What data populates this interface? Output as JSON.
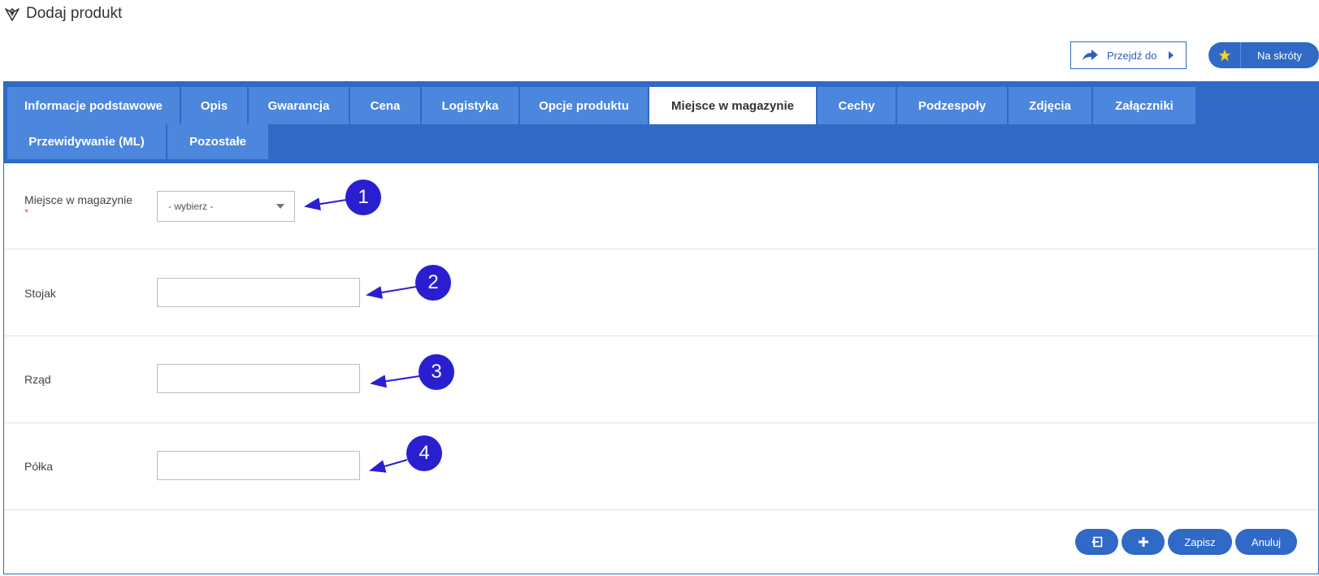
{
  "header": {
    "title": "Dodaj produkt",
    "goto_label": "Przejdź do",
    "shortcut_label": "Na skróty"
  },
  "tabs": [
    {
      "label": "Informacje podstawowe",
      "active": false
    },
    {
      "label": "Opis",
      "active": false
    },
    {
      "label": "Gwarancja",
      "active": false
    },
    {
      "label": "Cena",
      "active": false
    },
    {
      "label": "Logistyka",
      "active": false
    },
    {
      "label": "Opcje produktu",
      "active": false
    },
    {
      "label": "Miejsce w magazynie",
      "active": true
    },
    {
      "label": "Cechy",
      "active": false
    },
    {
      "label": "Podzespoły",
      "active": false
    },
    {
      "label": "Zdjęcia",
      "active": false
    },
    {
      "label": "Załączniki",
      "active": false
    },
    {
      "label": "Przewidywanie (ML)",
      "active": false
    },
    {
      "label": "Pozostałe",
      "active": false
    }
  ],
  "form": {
    "location": {
      "label": "Miejsce w magazynie",
      "required_mark": "*",
      "value": "- wybierz -"
    },
    "rack": {
      "label": "Stojak",
      "value": ""
    },
    "row": {
      "label": "Rząd",
      "value": ""
    },
    "shelf": {
      "label": "Półka",
      "value": ""
    }
  },
  "annotations": [
    "1",
    "2",
    "3",
    "4"
  ],
  "footer": {
    "save_label": "Zapisz",
    "cancel_label": "Anuluj"
  },
  "colors": {
    "primary": "#3069c6",
    "tab": "#4c86dd",
    "annotation": "#2a1fd0",
    "required": "#d9534f"
  },
  "icons": [
    "product-icon",
    "share-arrow-icon",
    "caret-right-icon",
    "star-icon",
    "dropdown-caret-icon",
    "back-icon",
    "plus-icon"
  ]
}
